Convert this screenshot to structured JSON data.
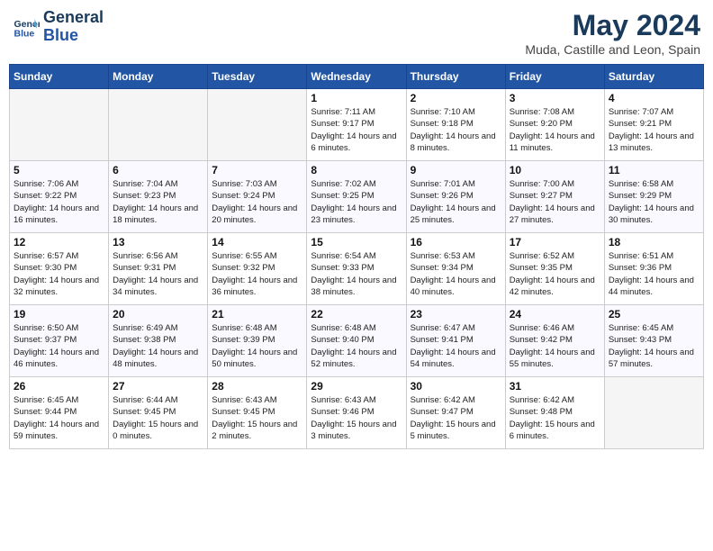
{
  "header": {
    "logo_line1": "General",
    "logo_line2": "Blue",
    "month": "May 2024",
    "location": "Muda, Castille and Leon, Spain"
  },
  "columns": [
    "Sunday",
    "Monday",
    "Tuesday",
    "Wednesday",
    "Thursday",
    "Friday",
    "Saturday"
  ],
  "weeks": [
    [
      {
        "day": "",
        "empty": true
      },
      {
        "day": "",
        "empty": true
      },
      {
        "day": "",
        "empty": true
      },
      {
        "day": "1",
        "sunrise": "7:11 AM",
        "sunset": "9:17 PM",
        "daylight": "14 hours and 6 minutes."
      },
      {
        "day": "2",
        "sunrise": "7:10 AM",
        "sunset": "9:18 PM",
        "daylight": "14 hours and 8 minutes."
      },
      {
        "day": "3",
        "sunrise": "7:08 AM",
        "sunset": "9:20 PM",
        "daylight": "14 hours and 11 minutes."
      },
      {
        "day": "4",
        "sunrise": "7:07 AM",
        "sunset": "9:21 PM",
        "daylight": "14 hours and 13 minutes."
      }
    ],
    [
      {
        "day": "5",
        "sunrise": "7:06 AM",
        "sunset": "9:22 PM",
        "daylight": "14 hours and 16 minutes."
      },
      {
        "day": "6",
        "sunrise": "7:04 AM",
        "sunset": "9:23 PM",
        "daylight": "14 hours and 18 minutes."
      },
      {
        "day": "7",
        "sunrise": "7:03 AM",
        "sunset": "9:24 PM",
        "daylight": "14 hours and 20 minutes."
      },
      {
        "day": "8",
        "sunrise": "7:02 AM",
        "sunset": "9:25 PM",
        "daylight": "14 hours and 23 minutes."
      },
      {
        "day": "9",
        "sunrise": "7:01 AM",
        "sunset": "9:26 PM",
        "daylight": "14 hours and 25 minutes."
      },
      {
        "day": "10",
        "sunrise": "7:00 AM",
        "sunset": "9:27 PM",
        "daylight": "14 hours and 27 minutes."
      },
      {
        "day": "11",
        "sunrise": "6:58 AM",
        "sunset": "9:29 PM",
        "daylight": "14 hours and 30 minutes."
      }
    ],
    [
      {
        "day": "12",
        "sunrise": "6:57 AM",
        "sunset": "9:30 PM",
        "daylight": "14 hours and 32 minutes."
      },
      {
        "day": "13",
        "sunrise": "6:56 AM",
        "sunset": "9:31 PM",
        "daylight": "14 hours and 34 minutes."
      },
      {
        "day": "14",
        "sunrise": "6:55 AM",
        "sunset": "9:32 PM",
        "daylight": "14 hours and 36 minutes."
      },
      {
        "day": "15",
        "sunrise": "6:54 AM",
        "sunset": "9:33 PM",
        "daylight": "14 hours and 38 minutes."
      },
      {
        "day": "16",
        "sunrise": "6:53 AM",
        "sunset": "9:34 PM",
        "daylight": "14 hours and 40 minutes."
      },
      {
        "day": "17",
        "sunrise": "6:52 AM",
        "sunset": "9:35 PM",
        "daylight": "14 hours and 42 minutes."
      },
      {
        "day": "18",
        "sunrise": "6:51 AM",
        "sunset": "9:36 PM",
        "daylight": "14 hours and 44 minutes."
      }
    ],
    [
      {
        "day": "19",
        "sunrise": "6:50 AM",
        "sunset": "9:37 PM",
        "daylight": "14 hours and 46 minutes."
      },
      {
        "day": "20",
        "sunrise": "6:49 AM",
        "sunset": "9:38 PM",
        "daylight": "14 hours and 48 minutes."
      },
      {
        "day": "21",
        "sunrise": "6:48 AM",
        "sunset": "9:39 PM",
        "daylight": "14 hours and 50 minutes."
      },
      {
        "day": "22",
        "sunrise": "6:48 AM",
        "sunset": "9:40 PM",
        "daylight": "14 hours and 52 minutes."
      },
      {
        "day": "23",
        "sunrise": "6:47 AM",
        "sunset": "9:41 PM",
        "daylight": "14 hours and 54 minutes."
      },
      {
        "day": "24",
        "sunrise": "6:46 AM",
        "sunset": "9:42 PM",
        "daylight": "14 hours and 55 minutes."
      },
      {
        "day": "25",
        "sunrise": "6:45 AM",
        "sunset": "9:43 PM",
        "daylight": "14 hours and 57 minutes."
      }
    ],
    [
      {
        "day": "26",
        "sunrise": "6:45 AM",
        "sunset": "9:44 PM",
        "daylight": "14 hours and 59 minutes."
      },
      {
        "day": "27",
        "sunrise": "6:44 AM",
        "sunset": "9:45 PM",
        "daylight": "15 hours and 0 minutes."
      },
      {
        "day": "28",
        "sunrise": "6:43 AM",
        "sunset": "9:45 PM",
        "daylight": "15 hours and 2 minutes."
      },
      {
        "day": "29",
        "sunrise": "6:43 AM",
        "sunset": "9:46 PM",
        "daylight": "15 hours and 3 minutes."
      },
      {
        "day": "30",
        "sunrise": "6:42 AM",
        "sunset": "9:47 PM",
        "daylight": "15 hours and 5 minutes."
      },
      {
        "day": "31",
        "sunrise": "6:42 AM",
        "sunset": "9:48 PM",
        "daylight": "15 hours and 6 minutes."
      },
      {
        "day": "",
        "empty": true
      }
    ]
  ]
}
